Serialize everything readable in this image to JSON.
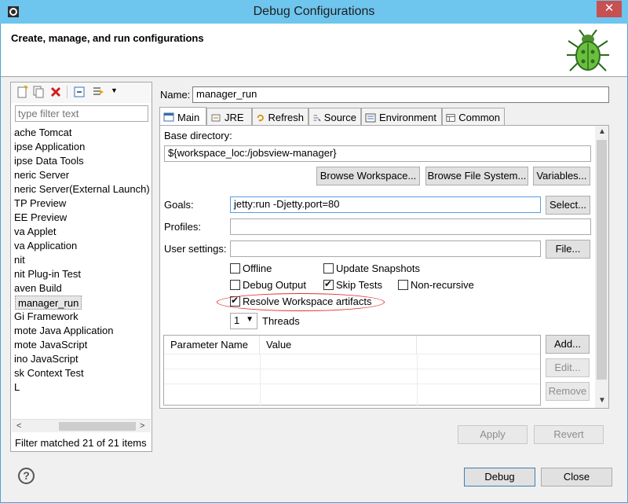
{
  "window": {
    "title": "Debug Configurations",
    "close_glyph": "✕"
  },
  "banner": {
    "heading": "Create, manage, and run configurations",
    "icon": "bug-icon"
  },
  "left": {
    "filter_placeholder": "type filter text",
    "items": [
      "ache Tomcat",
      "ipse Application",
      "ipse Data Tools",
      "neric Server",
      "neric Server(External Launch)",
      "TP Preview",
      "EE Preview",
      "va Applet",
      "va Application",
      "nit",
      "nit Plug-in Test",
      "aven Build",
      "manager_run",
      "Gi Framework",
      "mote Java Application",
      "mote JavaScript",
      "ino JavaScript",
      "sk Context Test",
      "L"
    ],
    "selected_index": 12,
    "status": "Filter matched 21 of 21 items"
  },
  "config": {
    "name_label": "Name:",
    "name_value": "manager_run",
    "tabs": [
      "Main",
      "JRE",
      "Refresh",
      "Source",
      "Environment",
      "Common"
    ],
    "active_tab": "Main",
    "base_dir_label": "Base directory:",
    "base_dir_value": "${workspace_loc:/jobsview-manager}",
    "browse_workspace": "Browse Workspace...",
    "browse_fs": "Browse File System...",
    "variables": "Variables...",
    "goals_label": "Goals:",
    "goals_value": "jetty:run -Djetty.port=80",
    "select_btn": "Select...",
    "profiles_label": "Profiles:",
    "profiles_value": "",
    "user_settings_label": "User settings:",
    "user_settings_value": "",
    "file_btn": "File...",
    "checkboxes": {
      "offline": {
        "label": "Offline",
        "checked": false
      },
      "update_snapshots": {
        "label": "Update Snapshots",
        "checked": false
      },
      "debug_output": {
        "label": "Debug Output",
        "checked": false
      },
      "skip_tests": {
        "label": "Skip Tests",
        "checked": true
      },
      "non_recursive": {
        "label": "Non-recursive",
        "checked": false
      },
      "resolve_ws": {
        "label": "Resolve Workspace artifacts",
        "checked": true
      }
    },
    "threads_value": "1",
    "threads_label": "Threads",
    "param_headers": [
      "Parameter Name",
      "Value"
    ],
    "add_btn": "Add...",
    "edit_btn": "Edit...",
    "remove_btn": "Remove"
  },
  "footer": {
    "apply": "Apply",
    "revert": "Revert",
    "debug": "Debug",
    "close": "Close",
    "help_glyph": "?"
  },
  "colors": {
    "titlebar": "#6ec5ee",
    "close": "#c75050",
    "highlight_ellipse": "#e03030"
  }
}
